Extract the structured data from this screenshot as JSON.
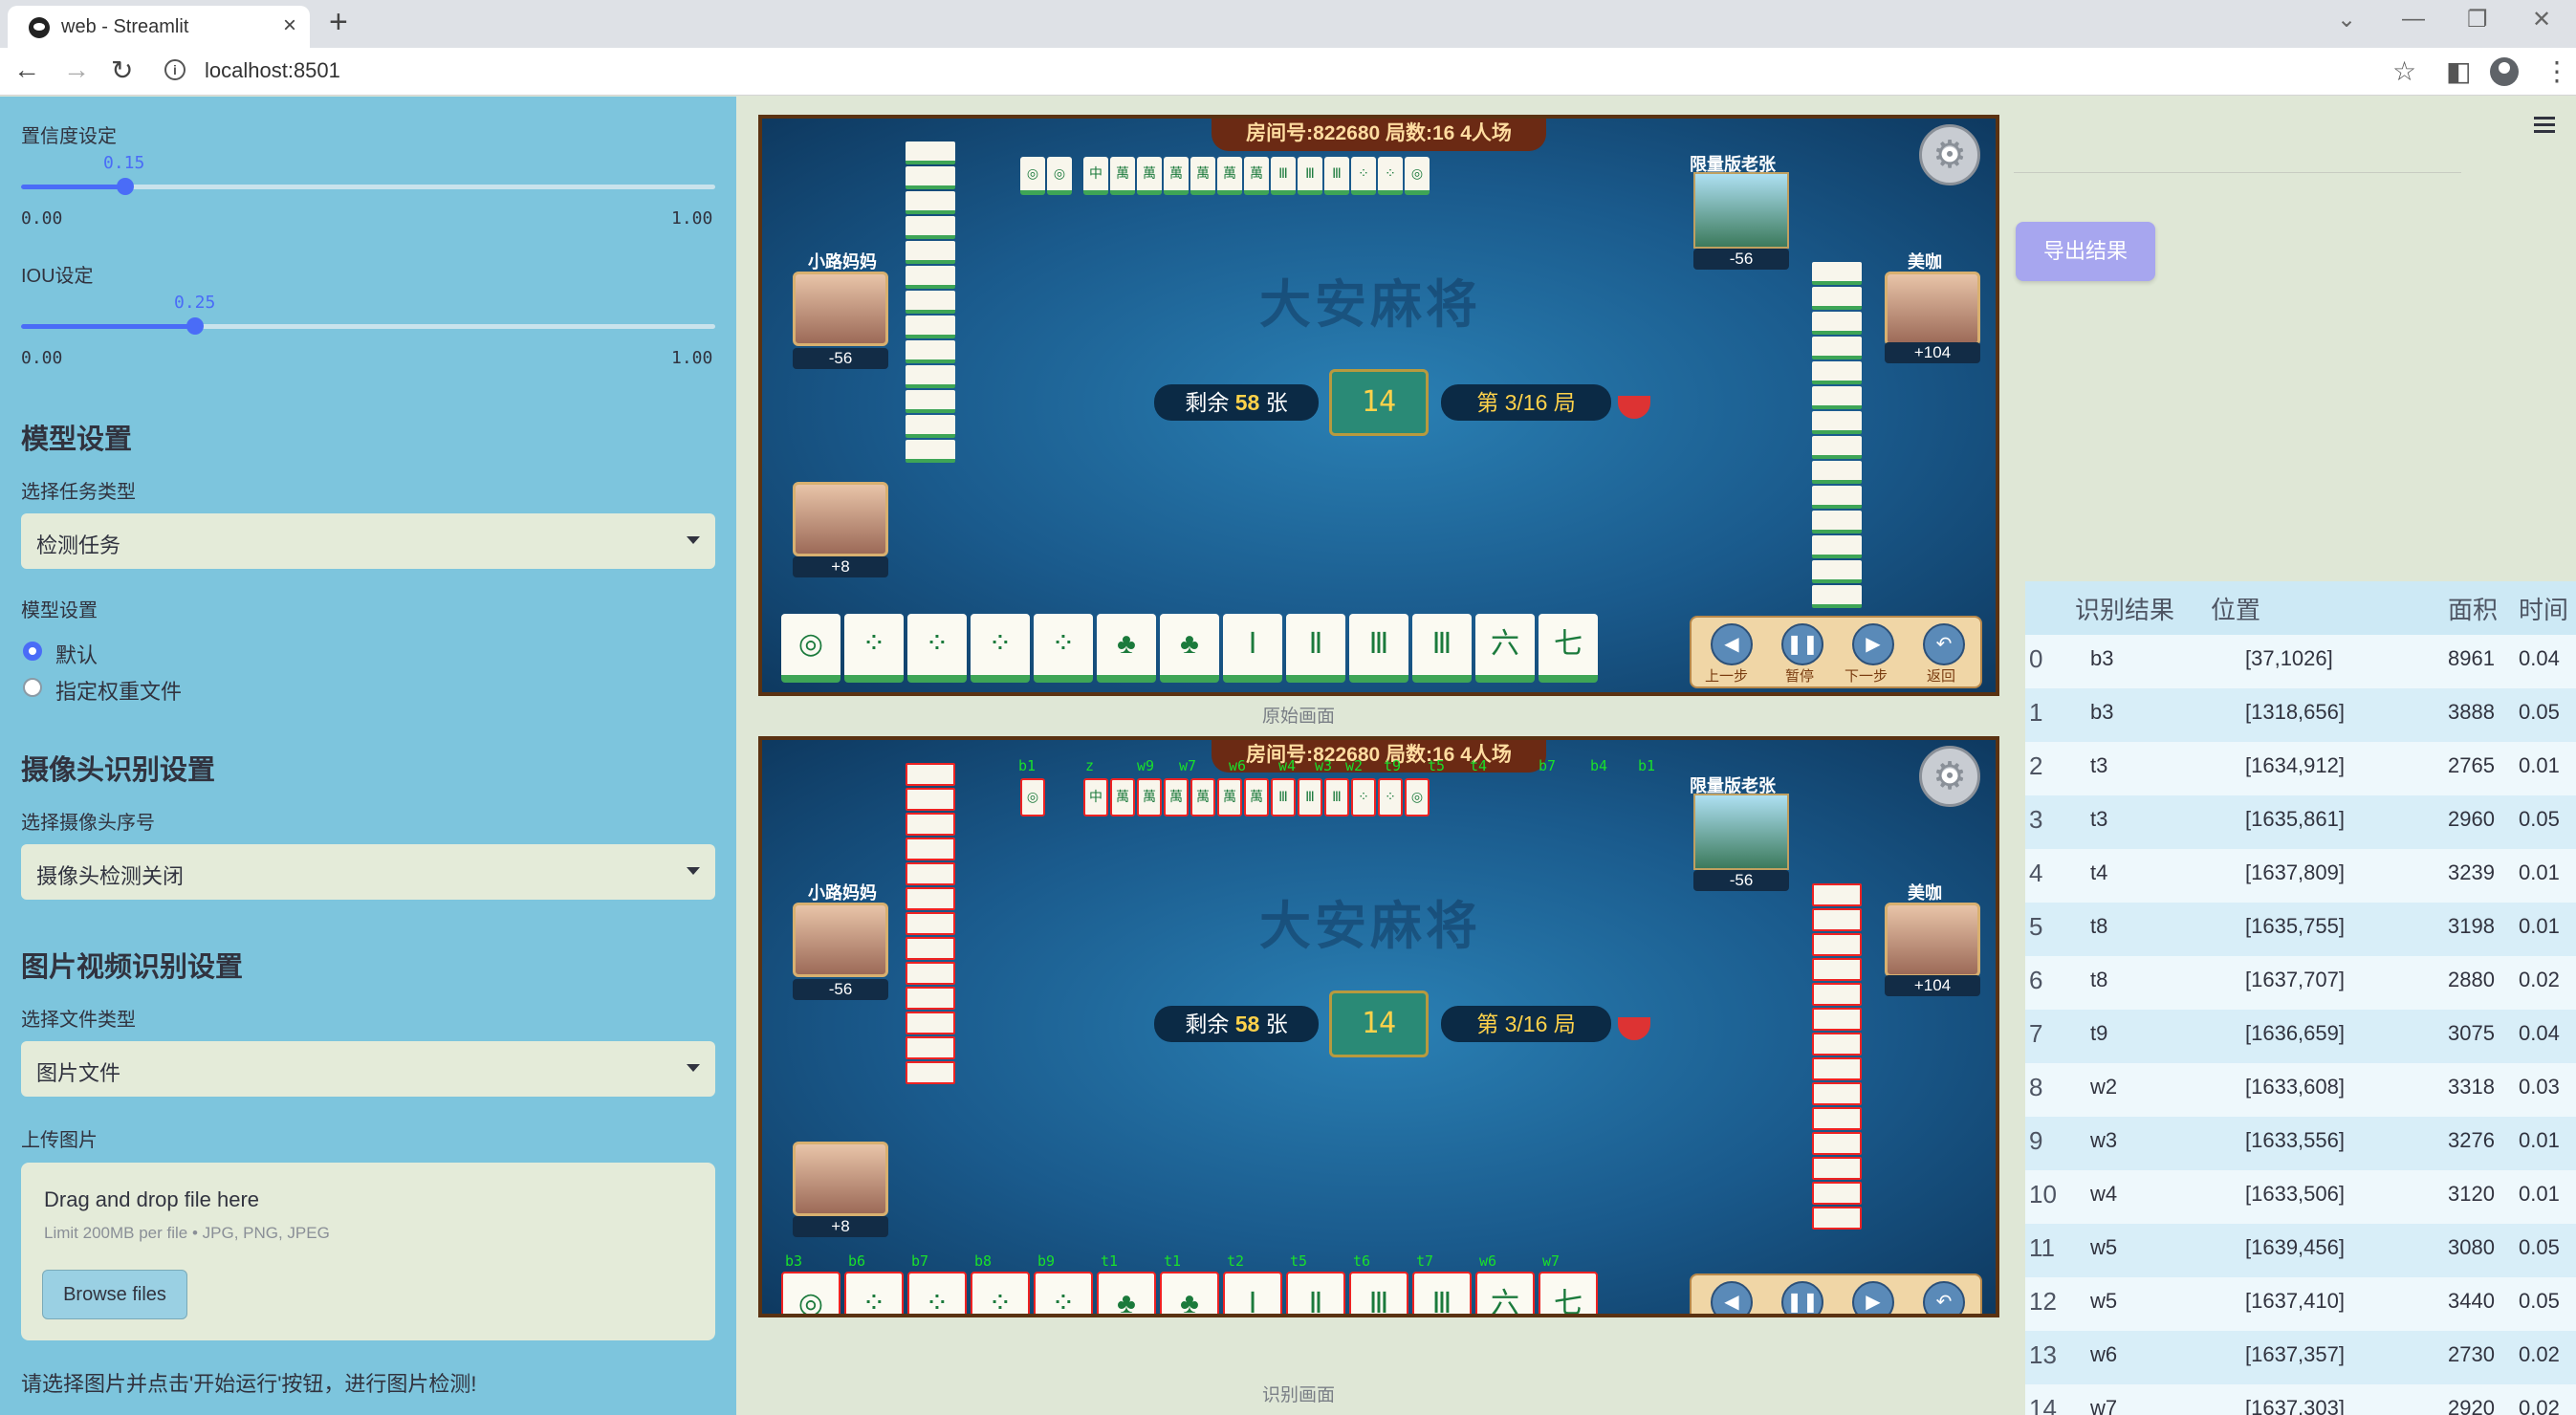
{
  "browser": {
    "tab_title": "web - Streamlit",
    "url": "localhost:8501"
  },
  "sidebar": {
    "conf": {
      "label": "置信度设定",
      "value": 0.15,
      "value_text": "0.15",
      "min": "0.00",
      "max": "1.00"
    },
    "iou": {
      "label": "IOU设定",
      "value": 0.25,
      "value_text": "0.25",
      "min": "0.00",
      "max": "1.00"
    },
    "model_heading": "模型设置",
    "task_label": "选择任务类型",
    "task_value": "检测任务",
    "model_label": "模型设置",
    "radio_default": "默认",
    "radio_custom": "指定权重文件",
    "camera_heading": "摄像头识别设置",
    "camera_label": "选择摄像头序号",
    "camera_value": "摄像头检测关闭",
    "media_heading": "图片视频识别设置",
    "filetype_label": "选择文件类型",
    "filetype_value": "图片文件",
    "upload_label": "上传图片",
    "upload_title": "Drag and drop file here",
    "upload_limit": "Limit 200MB per file • JPG, PNG, JPEG",
    "browse_label": "Browse files",
    "hint": "请选择图片并点击'开始运行'按钮，进行图片检测!"
  },
  "game": {
    "room": "房间号:822680 局数:16 4人场",
    "watermark": "大安麻将",
    "remain_prefix": "剩余",
    "remain_count": "58",
    "remain_suffix": "张",
    "dice": "14",
    "round": "第 3/16 局",
    "player_left": {
      "name": "小路妈妈",
      "score": "-56"
    },
    "player_left_bottom": {
      "score": "+8"
    },
    "player_right": {
      "name": "美咖",
      "score": "+104"
    },
    "player_top": {
      "score": "-56"
    },
    "lanzhang": "限量版老张",
    "controls": [
      "上一步",
      "暂停",
      "下一步",
      "返回"
    ],
    "caption_original": "原始画面",
    "caption_detected": "识别画面",
    "hand_tiles": [
      "◎",
      "⁘",
      "⁘",
      "⁘",
      "⁘",
      "♣",
      "♣",
      "Ⅰ",
      "Ⅱ",
      "Ⅲ",
      "Ⅲ",
      "六",
      "七"
    ],
    "hand_labels": [
      "b3",
      "b6",
      "b7",
      "b8",
      "b9",
      "t1",
      "t1",
      "t2",
      "t5",
      "t6",
      "t7",
      "w6",
      "w7"
    ],
    "top_labels": [
      "b1",
      "z",
      "w9",
      "w7",
      "w6",
      "w4",
      "w3",
      "w2",
      "t9",
      "t5",
      "t4",
      "b7",
      "b4",
      "b1"
    ]
  },
  "export_label": "导出结果",
  "table": {
    "headers": [
      "识别结果",
      "位置",
      "面积",
      "时间"
    ],
    "rows": [
      {
        "idx": "0",
        "cls": "b3",
        "pos": "[37,1026]",
        "area": "8961",
        "time": "0.04"
      },
      {
        "idx": "1",
        "cls": "b3",
        "pos": "[1318,656]",
        "area": "3888",
        "time": "0.05"
      },
      {
        "idx": "2",
        "cls": "t3",
        "pos": "[1634,912]",
        "area": "2765",
        "time": "0.01"
      },
      {
        "idx": "3",
        "cls": "t3",
        "pos": "[1635,861]",
        "area": "2960",
        "time": "0.05"
      },
      {
        "idx": "4",
        "cls": "t4",
        "pos": "[1637,809]",
        "area": "3239",
        "time": "0.01"
      },
      {
        "idx": "5",
        "cls": "t8",
        "pos": "[1635,755]",
        "area": "3198",
        "time": "0.01"
      },
      {
        "idx": "6",
        "cls": "t8",
        "pos": "[1637,707]",
        "area": "2880",
        "time": "0.02"
      },
      {
        "idx": "7",
        "cls": "t9",
        "pos": "[1636,659]",
        "area": "3075",
        "time": "0.04"
      },
      {
        "idx": "8",
        "cls": "w2",
        "pos": "[1633,608]",
        "area": "3318",
        "time": "0.03"
      },
      {
        "idx": "9",
        "cls": "w3",
        "pos": "[1633,556]",
        "area": "3276",
        "time": "0.01"
      },
      {
        "idx": "10",
        "cls": "w4",
        "pos": "[1633,506]",
        "area": "3120",
        "time": "0.01"
      },
      {
        "idx": "11",
        "cls": "w5",
        "pos": "[1639,456]",
        "area": "3080",
        "time": "0.05"
      },
      {
        "idx": "12",
        "cls": "w5",
        "pos": "[1637,410]",
        "area": "3440",
        "time": "0.05"
      },
      {
        "idx": "13",
        "cls": "w6",
        "pos": "[1637,357]",
        "area": "2730",
        "time": "0.02"
      },
      {
        "idx": "14",
        "cls": "w7",
        "pos": "[1637,303]",
        "area": "2920",
        "time": "0.02"
      }
    ]
  }
}
